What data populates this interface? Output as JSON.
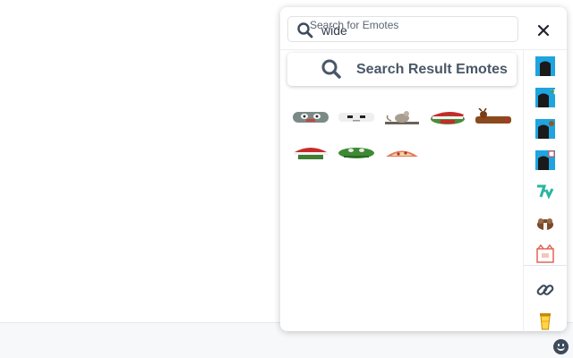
{
  "search": {
    "legend": "Search for Emotes",
    "value": "wide"
  },
  "results": {
    "label": "Search Result Emotes",
    "emotes": [
      {
        "name": "emote-wide-monka"
      },
      {
        "name": "emote-wide-stare"
      },
      {
        "name": "emote-wide-rat"
      },
      {
        "name": "emote-wide-santa-pepe"
      },
      {
        "name": "emote-wide-reindeer"
      },
      {
        "name": "emote-wide-santa-hat"
      },
      {
        "name": "emote-wide-peepo"
      },
      {
        "name": "emote-wide-pizza"
      }
    ]
  },
  "rail": {
    "icons": [
      "channel-emote-icon",
      "channel-emote-heart-icon",
      "channel-emote-cookie-icon",
      "channel-emote-calendar-icon",
      "seventv-icon",
      "bttv-icon",
      "calendar-cat-icon",
      "link-icon",
      "cup-icon"
    ]
  },
  "colors": {
    "accent": "#4a5768",
    "rail_blue": "#1fa4e0",
    "seventv": "#29b6a0"
  }
}
